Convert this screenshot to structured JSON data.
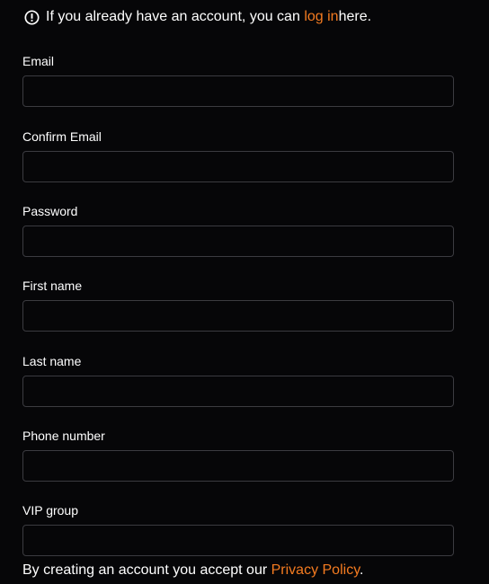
{
  "notice": {
    "prefix": "If you already have an account, you can ",
    "link": "log in",
    "suffix": " here."
  },
  "fields": [
    {
      "label": "Email",
      "value": "",
      "placeholder": ""
    },
    {
      "label": "Confirm Email",
      "value": "",
      "placeholder": ""
    },
    {
      "label": "Password",
      "value": "",
      "placeholder": ""
    },
    {
      "label": "First name",
      "value": "",
      "placeholder": ""
    },
    {
      "label": "Last name",
      "value": "",
      "placeholder": ""
    },
    {
      "label": "Phone number",
      "value": "",
      "placeholder": ""
    },
    {
      "label": "VIP group",
      "value": "",
      "placeholder": ""
    }
  ],
  "terms": {
    "prefix": "By creating an account you accept our ",
    "link": "Privacy Policy",
    "suffix": "."
  },
  "colors": {
    "background": "#060608",
    "accent": "#f47b20",
    "input_border": "#3b3b40"
  }
}
